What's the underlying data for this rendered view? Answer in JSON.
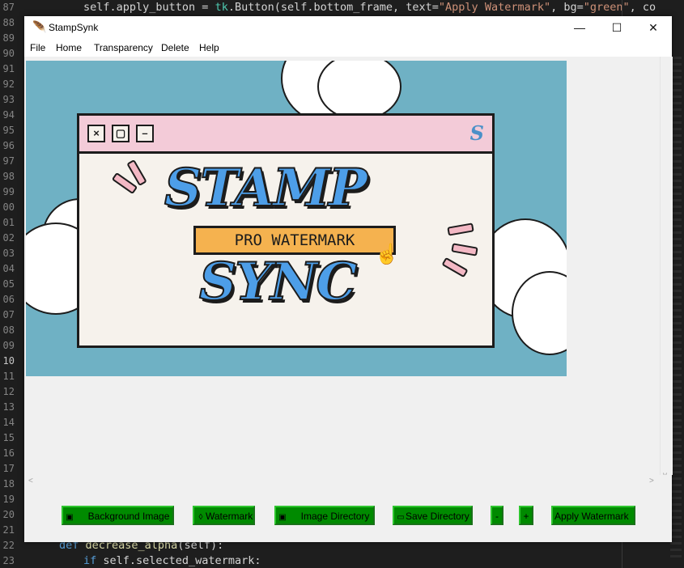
{
  "editor": {
    "line_numbers": [
      "87",
      "88",
      "89",
      "90",
      "91",
      "92",
      "93",
      "94",
      "95",
      "96",
      "97",
      "98",
      "99",
      "00",
      "01",
      "02",
      "03",
      "04",
      "05",
      "06",
      "07",
      "08",
      "09",
      "10",
      "11",
      "12",
      "13",
      "14",
      "15",
      "16",
      "17",
      "18",
      "19",
      "20",
      "21",
      "22",
      "23"
    ],
    "active_line": "10",
    "top_code": {
      "a": "self.apply_button = ",
      "b": "tk",
      "c": ".Button(self.bottom_frame, text=",
      "d": "\"Apply Watermark\"",
      "e": ", bg=",
      "f": "\"green\"",
      "g": ", co"
    },
    "bottom_code_1": {
      "kw": "def ",
      "fn": "decrease_alpha",
      "rest": "(self):"
    },
    "bottom_code_2": {
      "kw": "if ",
      "rest": "self.selected_watermark:"
    }
  },
  "window": {
    "title": "StampSynk",
    "app_icon": "feather-icon",
    "controls": {
      "minimize": "—",
      "maximize": "☐",
      "close": "✕"
    }
  },
  "menu": [
    "File",
    "Home",
    "Transparency",
    "Delete",
    "Help"
  ],
  "image": {
    "logo_text": "STAMP SYNC",
    "line1": "STAMP",
    "line2": "SYNC",
    "badge": "PRO WATERMARK",
    "small_logo": "S"
  },
  "scroll": {
    "left": "<",
    "right": ">",
    "up": "^",
    "down": "v"
  },
  "buttons": [
    {
      "label": "Background Image",
      "icon": "image-icon"
    },
    {
      "label": "Watermark",
      "icon": "drop-icon"
    },
    {
      "label": "Image Directory",
      "icon": "image-icon"
    },
    {
      "label": "Save Directory",
      "icon": "folder-icon"
    },
    {
      "label": "-",
      "icon": ""
    },
    {
      "label": "+",
      "icon": ""
    },
    {
      "label": "Apply Watermark",
      "icon": ""
    }
  ],
  "colors": {
    "button_bg": "#008a00",
    "image_bg": "#6fb1c4",
    "pink": "#f3cbd8",
    "blue_text": "#4d9ee8"
  }
}
